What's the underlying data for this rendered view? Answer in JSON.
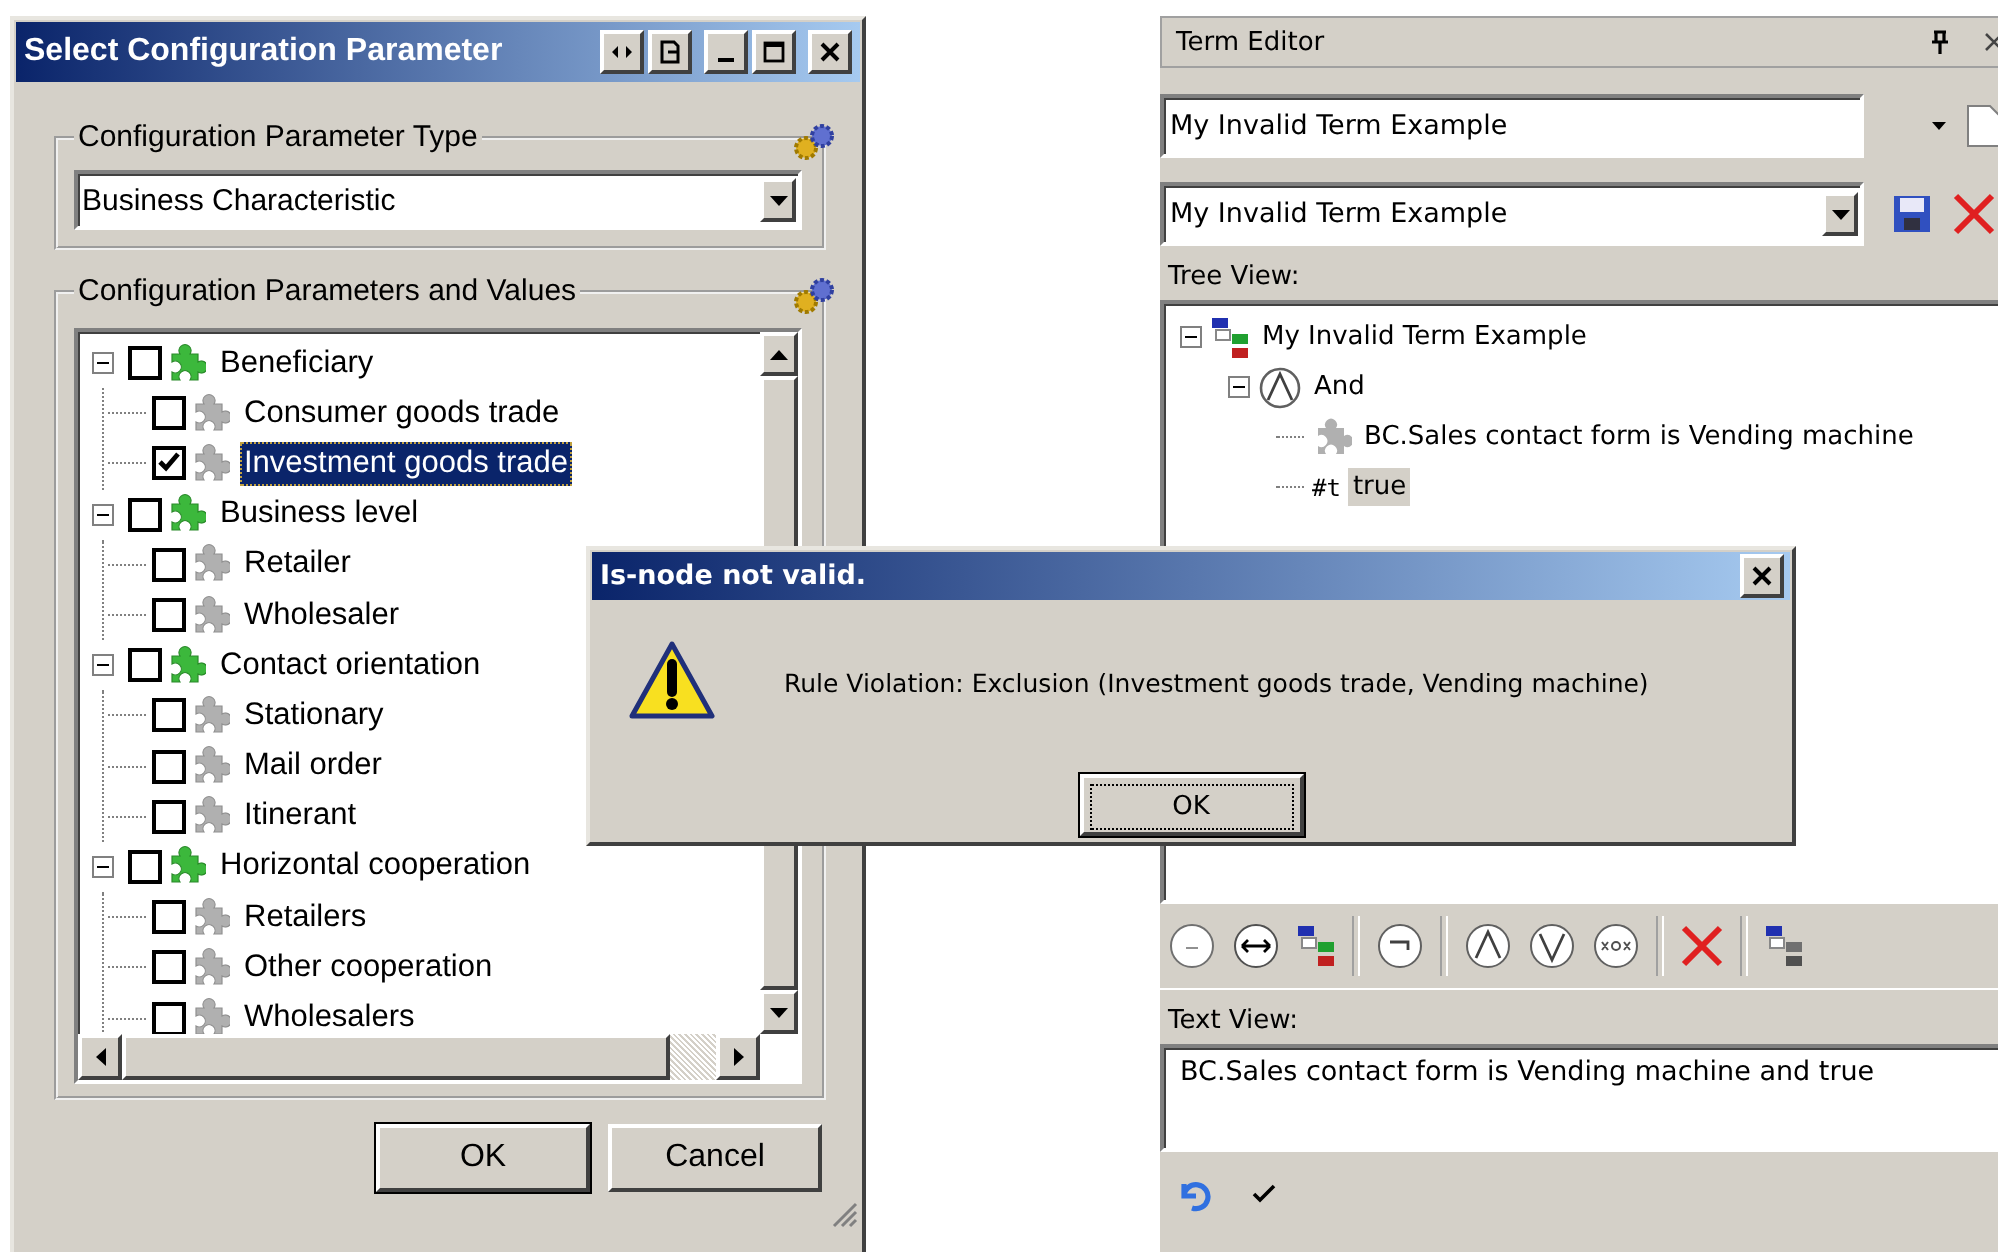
{
  "config_window": {
    "title": "Select Configuration Parameter",
    "type_group": {
      "label": "Configuration Parameter Type",
      "value": "Business Characteristic"
    },
    "values_group": {
      "label": "Configuration Parameters and Values",
      "tree": [
        {
          "label": "Beneficiary",
          "checked": false,
          "expanded": true,
          "selected": false,
          "children": [
            {
              "label": "Consumer goods trade",
              "checked": false,
              "selected": false
            },
            {
              "label": "Investment goods trade",
              "checked": true,
              "selected": true
            }
          ]
        },
        {
          "label": "Business level",
          "checked": false,
          "expanded": true,
          "selected": false,
          "children": [
            {
              "label": "Retailer",
              "checked": false,
              "selected": false
            },
            {
              "label": "Wholesaler",
              "checked": false,
              "selected": false
            }
          ]
        },
        {
          "label": "Contact orientation",
          "checked": false,
          "expanded": true,
          "selected": false,
          "children": [
            {
              "label": "Stationary",
              "checked": false,
              "selected": false
            },
            {
              "label": "Mail order",
              "checked": false,
              "selected": false
            },
            {
              "label": "Itinerant",
              "checked": false,
              "selected": false
            }
          ]
        },
        {
          "label": "Horizontal cooperation",
          "checked": false,
          "expanded": true,
          "selected": false,
          "children": [
            {
              "label": "Retailers",
              "checked": false,
              "selected": false
            },
            {
              "label": "Other cooperation",
              "checked": false,
              "selected": false
            },
            {
              "label": "Wholesalers",
              "checked": false,
              "selected": false
            }
          ]
        }
      ]
    },
    "buttons": [
      "OK",
      "Cancel"
    ]
  },
  "term_editor": {
    "title": "Term Editor",
    "name_field": "My Invalid Term Example",
    "term_select": "My Invalid Term Example",
    "tree_label": "Tree View:",
    "tree": [
      {
        "label": "My Invalid Term Example",
        "kind": "term",
        "expanded": true,
        "selected": false,
        "children": [
          {
            "label": "And",
            "kind": "and",
            "expanded": true,
            "selected": false,
            "children": [
              {
                "label": "BC.Sales contact form is Vending machine",
                "kind": "parameter",
                "selected": false
              },
              {
                "label": "true",
                "kind": "constant",
                "badge": "#t",
                "selected": true
              }
            ]
          }
        ]
      }
    ],
    "text_label": "Text View:",
    "text_value": "BC.Sales contact form is Vending machine and true"
  },
  "dialog": {
    "title": "Is-node not valid.",
    "message": "Rule Violation: Exclusion (Investment goods trade, Vending machine)",
    "button": "OK"
  }
}
